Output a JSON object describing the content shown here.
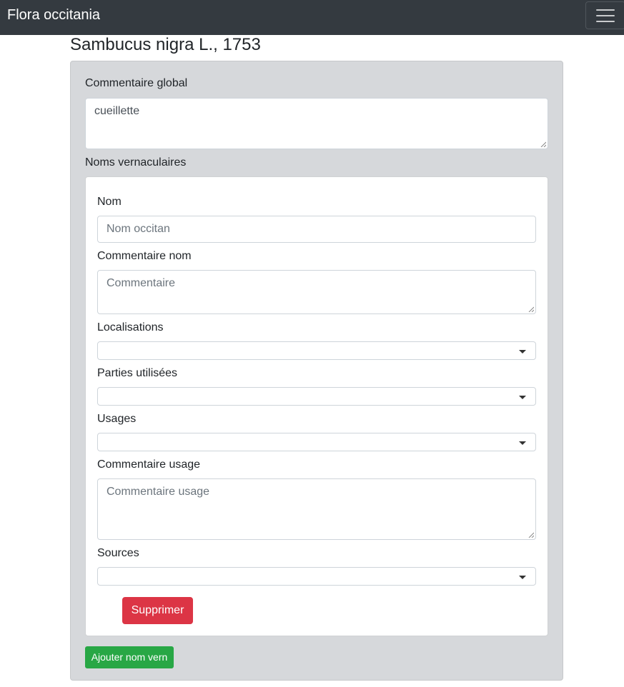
{
  "navbar": {
    "brand": "Flora occitania",
    "menu_icon": "hamburger-menu-icon"
  },
  "page": {
    "title": "Sambucus nigra L., 1753"
  },
  "form": {
    "global_comment": {
      "label": "Commentaire global",
      "value": "cueillette"
    },
    "vernacular_section_label": "Noms vernaculaires",
    "vernacular_entry": {
      "name": {
        "label": "Nom",
        "placeholder": "Nom occitan",
        "value": ""
      },
      "name_comment": {
        "label": "Commentaire nom",
        "placeholder": "Commentaire",
        "value": ""
      },
      "locations": {
        "label": "Localisations",
        "selected": ""
      },
      "parts_used": {
        "label": "Parties utilisées",
        "selected": ""
      },
      "uses": {
        "label": "Usages",
        "selected": ""
      },
      "use_comment": {
        "label": "Commentaire usage",
        "placeholder": "Commentaire usage",
        "value": ""
      },
      "sources": {
        "label": "Sources",
        "selected": ""
      },
      "delete_label": "Supprimer"
    },
    "add_vernacular_label": "Ajouter nom vern"
  },
  "colors": {
    "navbar": "#343a40",
    "panel": "#d6d8db",
    "danger": "#dc3545",
    "success": "#28a745"
  }
}
